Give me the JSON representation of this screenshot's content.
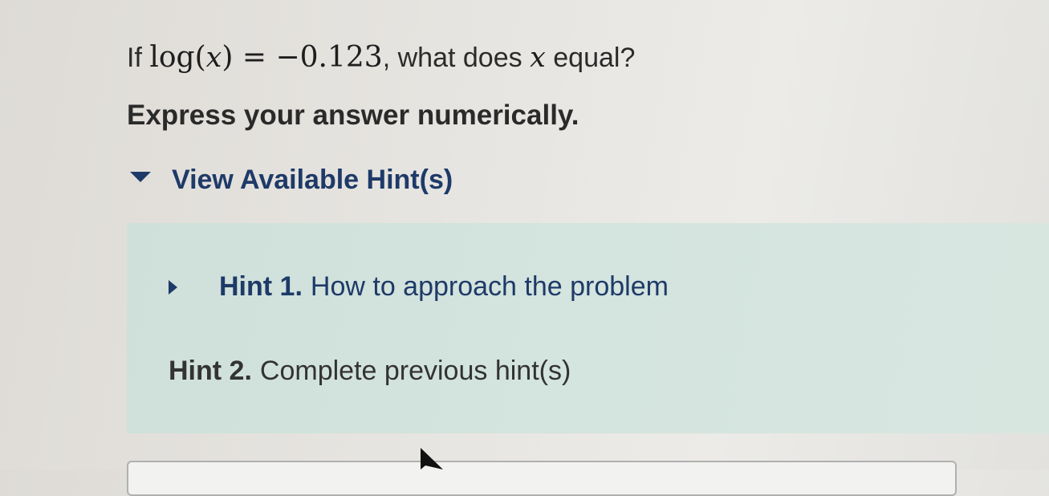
{
  "question": {
    "prefix": "If",
    "func": "log",
    "open_paren": "(",
    "var": "x",
    "close_paren": ")",
    "equals": " = −0.123",
    "middle": ", what does",
    "var2": "x",
    "suffix": "equal?"
  },
  "instruction": "Express your answer numerically.",
  "hints_toggle": {
    "label": "View Available Hint(s)",
    "icon": "caret-down-icon",
    "expanded": true
  },
  "hints": [
    {
      "number": "Hint 1.",
      "title": "How to approach the problem",
      "icon": "caret-right-icon"
    },
    {
      "number": "Hint 2.",
      "title": "Complete previous hint(s)"
    }
  ],
  "colors": {
    "link": "#1e3a68",
    "hint_panel": "#d4e4de",
    "text": "#2b2b2b"
  }
}
